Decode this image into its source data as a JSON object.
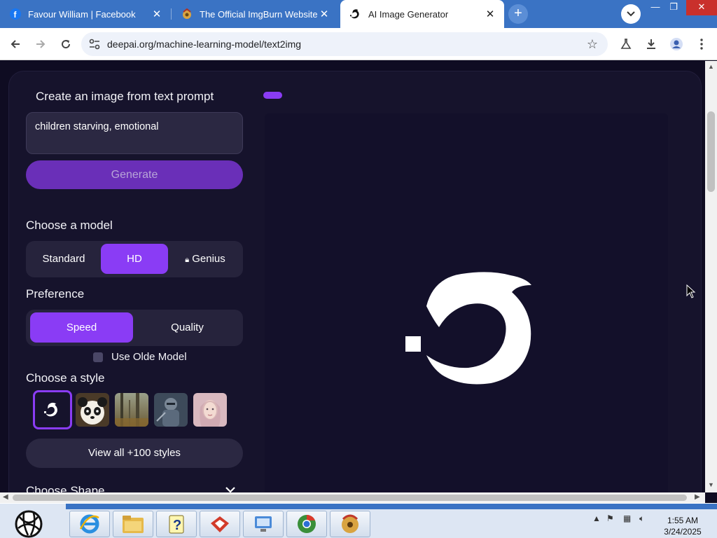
{
  "browser": {
    "tabs": [
      {
        "title": "Favour William | Facebook",
        "icon": "facebook-icon"
      },
      {
        "title": "The Official ImgBurn Website",
        "icon": "imgburn-icon"
      },
      {
        "title": "AI Image Generator",
        "icon": "deepai-icon",
        "active": true
      }
    ],
    "url": "deepai.org/machine-learning-model/text2img"
  },
  "sidebar": {
    "prompt_title": "Create an image from text prompt",
    "prompt_value": "children starving, emotional",
    "generate_label": "Generate",
    "model_label": "Choose a model",
    "models": [
      "Standard",
      "HD",
      "Genius"
    ],
    "model_selected": "HD",
    "preference_label": "Preference",
    "preferences": [
      "Speed",
      "Quality"
    ],
    "preference_selected": "Speed",
    "olde_model_label": "Use Olde Model",
    "style_label": "Choose a style",
    "styles": [
      "deepai-default",
      "panda",
      "forest",
      "armored-warrior",
      "portrait"
    ],
    "view_all_label": "View all +100 styles",
    "shape_label": "Choose Shape"
  },
  "taskbar": {
    "time": "1:55 AM",
    "date": "3/24/2025"
  },
  "colors": {
    "accent": "#8a3cf5",
    "page_bg": "#0f0c22",
    "chrome_blue": "#3a73c4"
  }
}
